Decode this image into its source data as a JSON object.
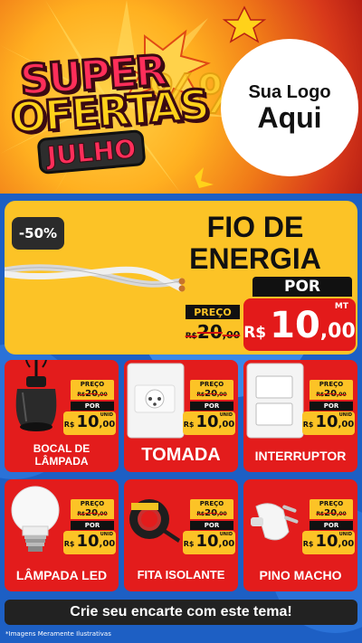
{
  "banner": {
    "logo_line1": "SUPER",
    "logo_line2": "OFERTAS",
    "logo_month": "JULHO",
    "bg_percent": "%%%",
    "brand_circle_line1": "Sua Logo",
    "brand_circle_line2": "Aqui"
  },
  "feature": {
    "discount_badge": "-50%",
    "title_line1": "FIO DE",
    "title_line2": "ENERGIA",
    "por_label": "POR",
    "preco_label": "PREÇO",
    "old_currency": "R$",
    "old_int": "20",
    "old_dec": ",00",
    "new_currency": "R$",
    "new_int": "10",
    "new_dec": ",00",
    "unit": "MT",
    "image_icon": "electrical-wire-icon"
  },
  "products": [
    {
      "name_line1": "BOCAL DE",
      "name_line2": "LÂMPADA",
      "preco_label": "PREÇO",
      "old_currency": "R$",
      "old_int": "20",
      "old_dec": ",00",
      "por_label": "POR",
      "new_currency": "R$",
      "new_int": "10",
      "new_dec": ",00",
      "unit": "UNID",
      "icon": "lamp-socket-icon"
    },
    {
      "name_line1": "TOMADA",
      "name_line2": "",
      "preco_label": "PREÇO",
      "old_currency": "R$",
      "old_int": "20",
      "old_dec": ",00",
      "por_label": "POR",
      "new_currency": "R$",
      "new_int": "10",
      "new_dec": ",00",
      "unit": "UNID",
      "icon": "power-outlet-icon"
    },
    {
      "name_line1": "INTERRUPTOR",
      "name_line2": "",
      "preco_label": "PREÇO",
      "old_currency": "R$",
      "old_int": "20",
      "old_dec": ",00",
      "por_label": "POR",
      "new_currency": "R$",
      "new_int": "10",
      "new_dec": ",00",
      "unit": "UNID",
      "icon": "light-switch-icon"
    },
    {
      "name_line1": "LÂMPADA LED",
      "name_line2": "",
      "preco_label": "PREÇO",
      "old_currency": "R$",
      "old_int": "20",
      "old_dec": ",00",
      "por_label": "POR",
      "new_currency": "R$",
      "new_int": "10",
      "new_dec": ",00",
      "unit": "UNID",
      "icon": "led-bulb-icon"
    },
    {
      "name_line1": "FITA ISOLANTE",
      "name_line2": "",
      "preco_label": "PREÇO",
      "old_currency": "R$",
      "old_int": "20",
      "old_dec": ",00",
      "por_label": "POR",
      "new_currency": "R$",
      "new_int": "10",
      "new_dec": ",00",
      "unit": "UNID",
      "icon": "insulating-tape-icon"
    },
    {
      "name_line1": "PINO MACHO",
      "name_line2": "",
      "preco_label": "PREÇO",
      "old_currency": "R$",
      "old_int": "20",
      "old_dec": ",00",
      "por_label": "POR",
      "new_currency": "R$",
      "new_int": "10",
      "new_dec": ",00",
      "unit": "UNID",
      "icon": "male-plug-icon"
    }
  ],
  "footer": {
    "cta": "Crie seu encarte com este tema!",
    "disclaimer": "*Imagens Meramente Ilustrativas"
  },
  "colors": {
    "background": "#1d5fc4",
    "feature_card": "#fcc326",
    "product_card": "#e31c1c",
    "price_box": "#fcc326",
    "footer_bar": "#222222"
  }
}
